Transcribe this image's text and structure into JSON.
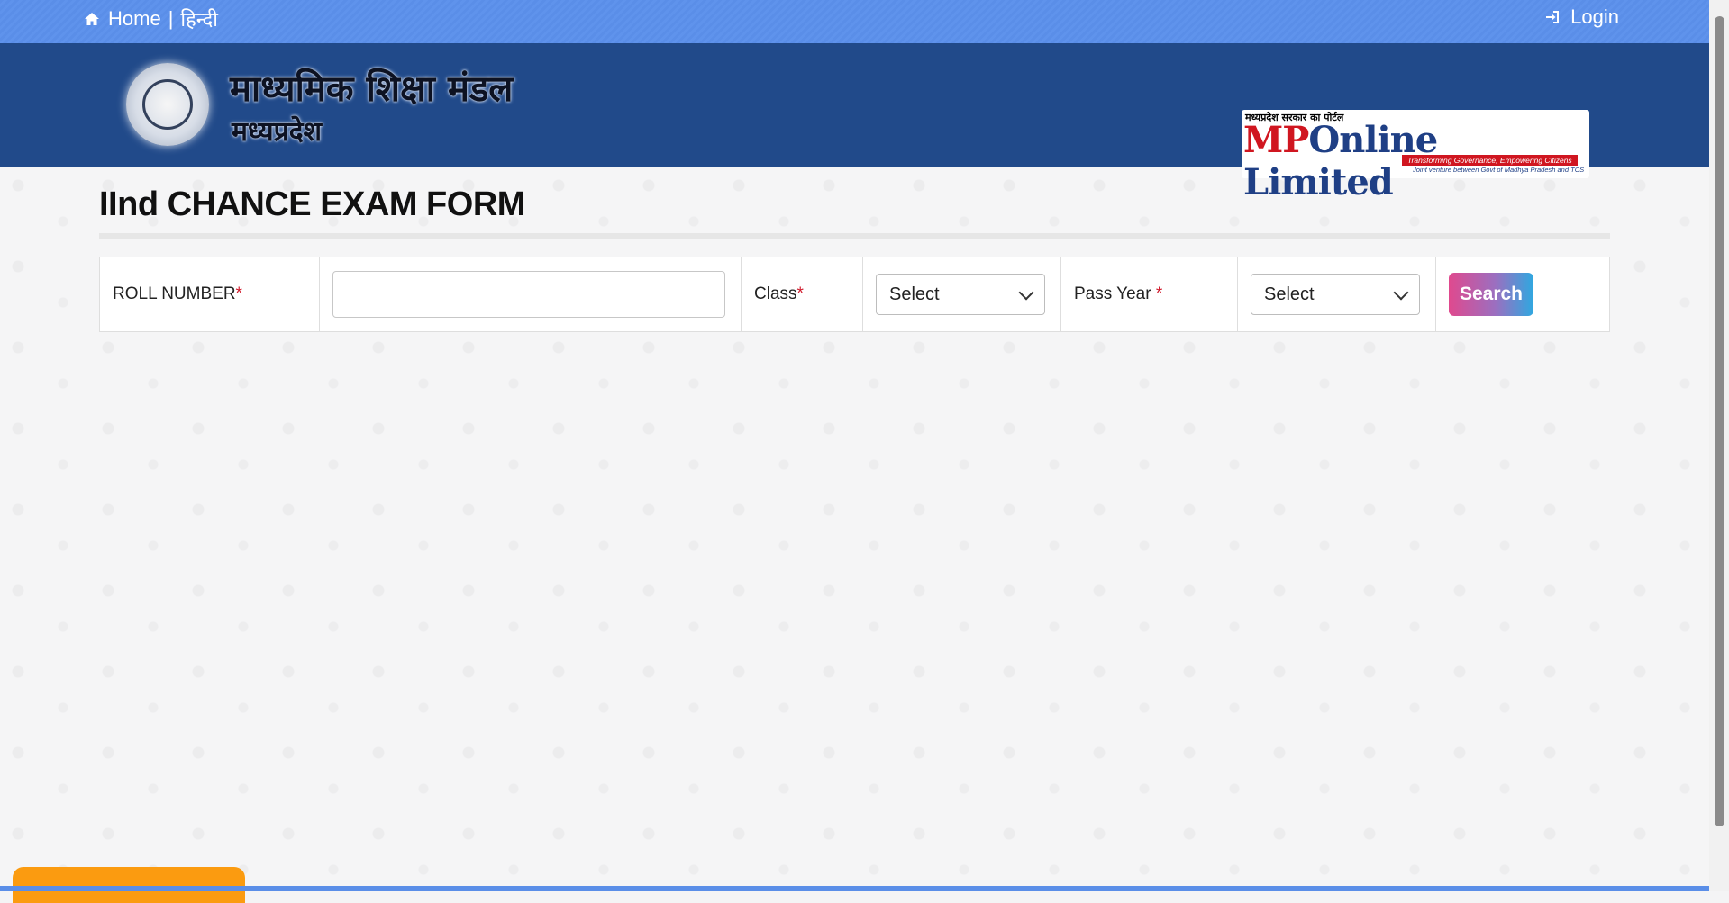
{
  "topbar": {
    "home_label": "Home",
    "separator": "|",
    "hindi_label": "हिन्दी",
    "login_label": "Login"
  },
  "header": {
    "board_title": "माध्यमिक शिक्षा मंडल",
    "board_subtitle": "मध्यप्रदेश",
    "partner_top": "मध्यप्रदेश सरकार का पोर्टल",
    "partner_mp": "MP",
    "partner_online": "Online Limited",
    "partner_tagline": "Transforming Governance, Empowering Citizens",
    "partner_jv": "Joint venture between Govt of Madhya Pradesh and TCS"
  },
  "page": {
    "title": "IInd CHANCE EXAM FORM"
  },
  "form": {
    "roll_label": "ROLL NUMBER",
    "required_mark": "*",
    "roll_value": "",
    "class_label": "Class",
    "class_selected": "Select",
    "passyear_label": "Pass Year ",
    "passyear_selected": "Select",
    "search_label": "Search"
  },
  "colors": {
    "topbar": "#5a8ee8",
    "header": "#214a8a",
    "required": "#d0182a",
    "orange_tab": "#fb9b10"
  }
}
